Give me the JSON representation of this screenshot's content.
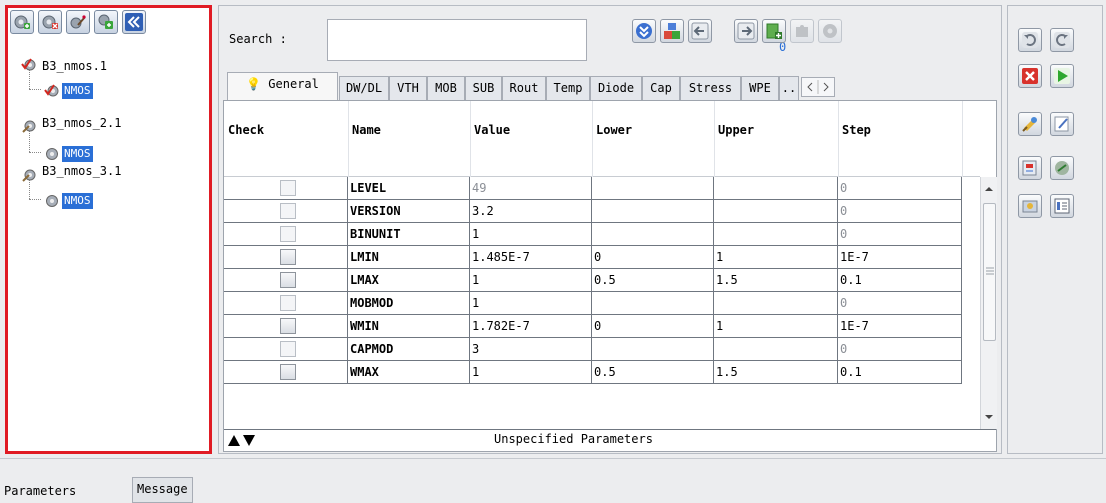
{
  "tree": {
    "items": [
      {
        "label": "B3_nmos.1",
        "child": "NMOS"
      },
      {
        "label": "B3_nmos_2.1",
        "child": "NMOS"
      },
      {
        "label": "B3_nmos_3.1",
        "child": "NMOS"
      }
    ]
  },
  "search": {
    "label": "Search :",
    "value": ""
  },
  "nav": {
    "count": "0"
  },
  "tabs": [
    "General",
    "DW/DL",
    "VTH",
    "MOB",
    "SUB",
    "Rout",
    "Temp",
    "Diode",
    "Cap",
    "Stress",
    "WPE",
    ".."
  ],
  "table": {
    "columns": [
      "Check",
      "Name",
      "Value",
      "Lower",
      "Upper",
      "Step"
    ],
    "rows": [
      {
        "checkbox": "disabled",
        "name": "LEVEL",
        "value": "49",
        "lower": "",
        "upper": "",
        "step": "0",
        "value_grey": true,
        "step_grey": true
      },
      {
        "checkbox": "disabled",
        "name": "VERSION",
        "value": "3.2",
        "lower": "",
        "upper": "",
        "step": "0",
        "value_grey": false,
        "step_grey": true
      },
      {
        "checkbox": "disabled",
        "name": "BINUNIT",
        "value": "1",
        "lower": "",
        "upper": "",
        "step": "0",
        "value_grey": false,
        "step_grey": true
      },
      {
        "checkbox": "enabled",
        "name": "LMIN",
        "value": "1.485E-7",
        "lower": "0",
        "upper": "1",
        "step": "1E-7",
        "value_grey": false,
        "step_grey": false
      },
      {
        "checkbox": "enabled",
        "name": "LMAX",
        "value": "1",
        "lower": "0.5",
        "upper": "1.5",
        "step": "0.1",
        "value_grey": false,
        "step_grey": false
      },
      {
        "checkbox": "disabled",
        "name": "MOBMOD",
        "value": "1",
        "lower": "",
        "upper": "",
        "step": "0",
        "value_grey": false,
        "step_grey": true
      },
      {
        "checkbox": "enabled",
        "name": "WMIN",
        "value": "1.782E-7",
        "lower": "0",
        "upper": "1",
        "step": "1E-7",
        "value_grey": false,
        "step_grey": false
      },
      {
        "checkbox": "disabled",
        "name": "CAPMOD",
        "value": "3",
        "lower": "",
        "upper": "",
        "step": "0",
        "value_grey": false,
        "step_grey": true
      },
      {
        "checkbox": "enabled",
        "name": "WMAX",
        "value": "1",
        "lower": "0.5",
        "upper": "1.5",
        "step": "0.1",
        "value_grey": false,
        "step_grey": false
      }
    ],
    "footer": "Unspecified Parameters"
  },
  "bottom_tabs": [
    "Parameters",
    "Message"
  ],
  "colors": {
    "highlight": "#e01b24",
    "selection": "#2a6fd6"
  }
}
